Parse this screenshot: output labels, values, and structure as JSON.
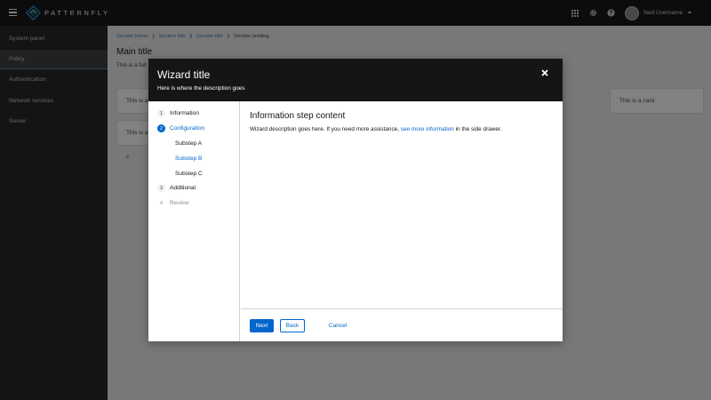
{
  "masthead": {
    "brand": "PATTERNFLY",
    "user_name": "Ned Username"
  },
  "sidebar": {
    "items": [
      {
        "label": "System panel"
      },
      {
        "label": "Policy"
      },
      {
        "label": "Authentication"
      },
      {
        "label": "Network services"
      },
      {
        "label": "Server"
      }
    ]
  },
  "page": {
    "breadcrumb": {
      "links": [
        "Section home",
        "Section title",
        "Section title"
      ],
      "current": "Section landing"
    },
    "title": "Main title",
    "description": "This is a full",
    "cards": [
      "This is a c",
      "This is a c",
      "This is a card"
    ]
  },
  "wizard": {
    "title": "Wizard title",
    "description": "Here is where the description goes",
    "steps": [
      {
        "number": "1",
        "label": "Information"
      },
      {
        "number": "2",
        "label": "Configuration"
      },
      {
        "label": "Substep A"
      },
      {
        "label": "Substep B"
      },
      {
        "label": "Substep C"
      },
      {
        "number": "3",
        "label": "Additional"
      },
      {
        "number": "4",
        "label": "Review"
      }
    ],
    "content": {
      "title": "Information step content",
      "text_before": "Wizard description goes here. If you need more assistance, ",
      "link": "see more information",
      "text_after": " in the side drawer."
    },
    "buttons": {
      "next": "Next",
      "back": "Back",
      "cancel": "Cancel"
    }
  },
  "colors": {
    "primary": "#0066cc",
    "masthead": "#151515",
    "sidebar": "#212427"
  }
}
